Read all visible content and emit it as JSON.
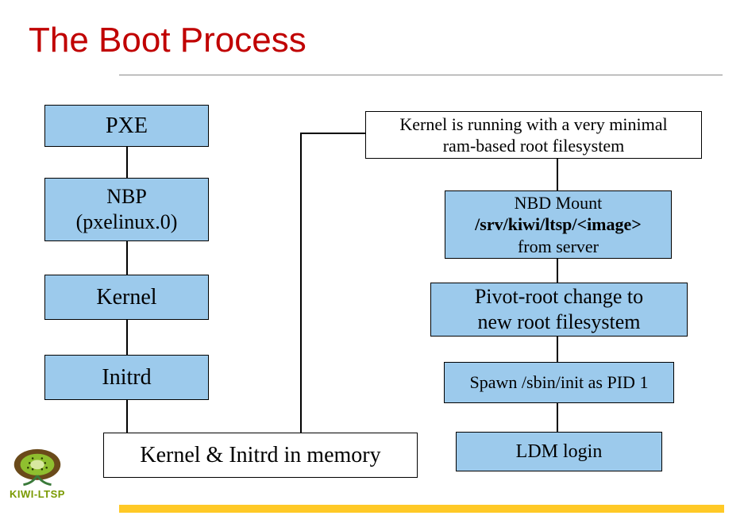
{
  "title": "The Boot Process",
  "left_chain": {
    "pxe": "PXE",
    "nbp_line1": "NBP",
    "nbp_line2": "(pxelinux.0)",
    "kernel": "Kernel",
    "initrd": "Initrd"
  },
  "center": {
    "kernel_initrd_mem": "Kernel & Initrd in memory",
    "ram_root_line1": "Kernel is running with a very minimal",
    "ram_root_line2": "ram-based root filesystem"
  },
  "right_chain": {
    "nbd_line1": "NBD Mount",
    "nbd_line2": "/srv/kiwi/ltsp/<image>",
    "nbd_line3": "from server",
    "pivot_line1": "Pivot-root change to",
    "pivot_line2": "new root filesystem",
    "spawn": "Spawn /sbin/init as PID 1",
    "ldm": "LDM login"
  },
  "logo_text": "KIWI-LTSP"
}
